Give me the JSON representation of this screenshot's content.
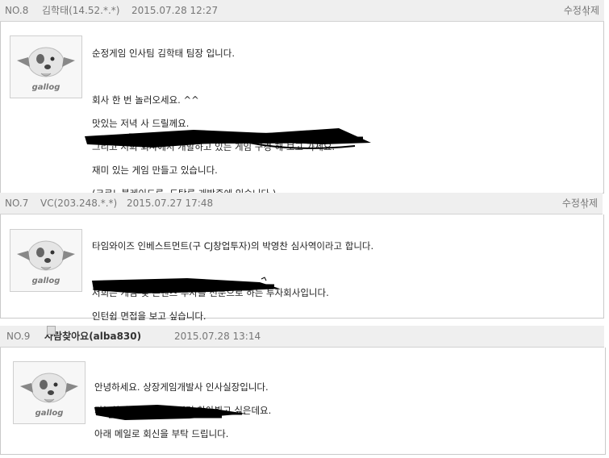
{
  "posts": [
    {
      "no": "NO.8",
      "author": "김학태(14.52.*.*)",
      "date": "2015.07.28 12:27",
      "actions": {
        "edit": "수정",
        "delete": "삭제"
      },
      "avatar_text": "gallog",
      "lines": [
        "순정게임 인사팀 김학태 팀장 입니다.",
        "",
        "회사 한 번 놀러오세요. ^^",
        "맛있는 저녁 사 드릴께요.",
        "그리고 저희 회사에서 개발하고 있는 게임 구경 해 보고 가세요.",
        "재미 있는 게임 만들고 있습니다.",
        "(크로노블레이드류, 도탑류 개발중에 있습니다.)"
      ]
    },
    {
      "no": "NO.7",
      "author": "VC(203.248.*.*)",
      "date": "2015.07.27 17:48",
      "actions": {
        "edit": "수정",
        "delete": "삭제"
      },
      "avatar_text": "gallog",
      "lines": [
        "타임와이즈 인베스트먼트(구 CJ창업투자)의 박영찬 심사역이라고 합니다.",
        "",
        "저희는 게임 및 콘텐츠 투자를 전문으로 하는 투자회사입니다.",
        "인턴쉽 면접을 보고 싶습니다."
      ]
    },
    {
      "no": "NO.9",
      "author": "사람찾아요(alba830)",
      "date": "2015.07.28 13:14",
      "avatar_text": "gallog",
      "lines": [
        "안녕하세요. 상장게임개발사 인사실장입니다.",
        "가능하신 시간 알려주시면 찾아뵙고 싶은데요.",
        "아래 메일로 회신을 부탁 드립니다."
      ]
    }
  ]
}
